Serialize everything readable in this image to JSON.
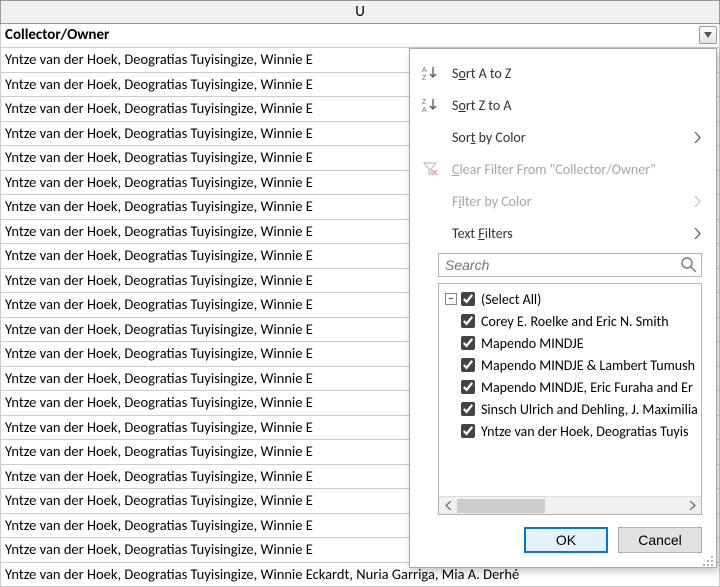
{
  "column": {
    "letter": "U",
    "header": "Collector/Owner"
  },
  "rows": [
    "Yntze van der Hoek, Deogratias Tuyisingize, Winnie E",
    "Yntze van der Hoek, Deogratias Tuyisingize, Winnie E",
    "Yntze van der Hoek, Deogratias Tuyisingize, Winnie E",
    "Yntze van der Hoek, Deogratias Tuyisingize, Winnie E",
    "Yntze van der Hoek, Deogratias Tuyisingize, Winnie E",
    "Yntze van der Hoek, Deogratias Tuyisingize, Winnie E",
    "Yntze van der Hoek, Deogratias Tuyisingize, Winnie E",
    "Yntze van der Hoek, Deogratias Tuyisingize, Winnie E",
    "Yntze van der Hoek, Deogratias Tuyisingize, Winnie E",
    "Yntze van der Hoek, Deogratias Tuyisingize, Winnie E",
    "Yntze van der Hoek, Deogratias Tuyisingize, Winnie E",
    "Yntze van der Hoek, Deogratias Tuyisingize, Winnie E",
    "Yntze van der Hoek, Deogratias Tuyisingize, Winnie E",
    "Yntze van der Hoek, Deogratias Tuyisingize, Winnie E",
    "Yntze van der Hoek, Deogratias Tuyisingize, Winnie E",
    "Yntze van der Hoek, Deogratias Tuyisingize, Winnie E",
    "Yntze van der Hoek, Deogratias Tuyisingize, Winnie E",
    "Yntze van der Hoek, Deogratias Tuyisingize, Winnie E",
    "Yntze van der Hoek, Deogratias Tuyisingize, Winnie E",
    "Yntze van der Hoek, Deogratias Tuyisingize, Winnie E",
    "Yntze van der Hoek, Deogratias Tuyisingize, Winnie E",
    "Yntze van der Hoek, Deogratias Tuyisingize, Winnie Eckardt, Nuria Garriga, Mia A. Derhé"
  ],
  "filter": {
    "sort_az": "Sort A to Z",
    "sort_za": "Sort Z to A",
    "sort_color": "Sort by Color",
    "clear_filter": "Clear Filter From \"Collector/Owner\"",
    "filter_color": "Filter by Color",
    "text_filters": "Text Filters",
    "search_placeholder": "Search",
    "select_all": "(Select All)",
    "items": [
      "Corey E. Roelke and Eric N. Smith",
      "Mapendo MINDJE",
      "Mapendo MINDJE & Lambert Tumush",
      "Mapendo MINDJE, Eric Furaha and Er",
      "Sinsch Ulrich and Dehling, J. Maximilia",
      "Yntze van der Hoek, Deogratias Tuyis"
    ],
    "ok": "OK",
    "cancel": "Cancel"
  }
}
